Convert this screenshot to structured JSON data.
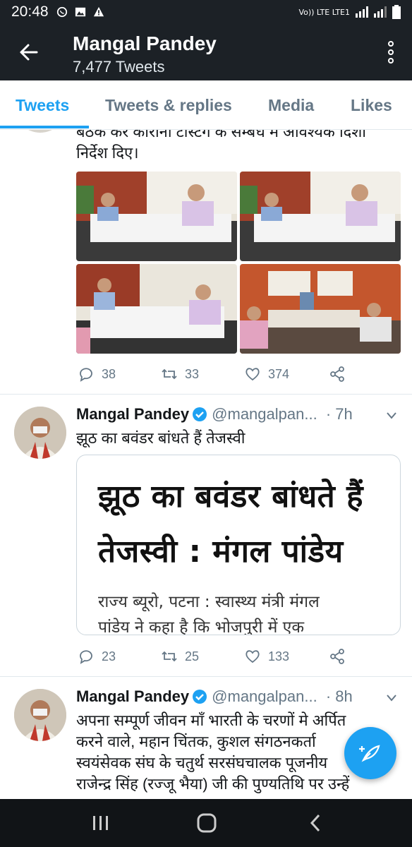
{
  "status_bar": {
    "time": "20:48",
    "network": "Vo)) LTE LTE1",
    "icons": [
      "whatsapp-icon",
      "gallery-icon",
      "warning-icon",
      "signal-icon",
      "battery-icon"
    ]
  },
  "app_bar": {
    "title": "Mangal Pandey",
    "subtitle": "7,477 Tweets"
  },
  "tabs": [
    {
      "label": "Tweets",
      "active": true
    },
    {
      "label": "Tweets & replies",
      "active": false
    },
    {
      "label": "Media",
      "active": false
    },
    {
      "label": "Likes",
      "active": false
    }
  ],
  "tweets": [
    {
      "text_partial": "बैठक कर कोरोना टेस्टिंग के सम्बंध में आवश्यक दिशा",
      "text_line2": "निर्देश दिए।",
      "photos": [
        "meeting-photo-1",
        "meeting-photo-2",
        "meeting-photo-3",
        "meeting-photo-4"
      ],
      "replies": "38",
      "retweets": "33",
      "likes": "374"
    },
    {
      "name": "Mangal Pandey",
      "handle": "@mangalpan...",
      "time": "· 7h",
      "text": "झूठ का बवंडर बांधते हैं तेजस्वी",
      "card": {
        "headline_line1": "झूठ का बवंडर बांधते हैं",
        "headline_line2": "तेजस्वी : मंगल पांडेय",
        "body_line1": "राज्य ब्यूरो, पटना : स्वास्थ्य मंत्री मंगल",
        "body_line2": "पांडेय ने कहा है कि भोजपुरी में एक"
      },
      "replies": "23",
      "retweets": "25",
      "likes": "133"
    },
    {
      "name": "Mangal Pandey",
      "handle": "@mangalpan...",
      "time": "· 8h",
      "lines": [
        "अपना सम्पूर्ण जीवन माँ भारती के चरणों मे अर्पित",
        "करने वाले, महान चिंतक, कुशल संगठनकर्ता",
        "स्वयंसेवक संघ के चतुर्थ सरसंघचालक पूजनीय",
        "राजेन्द्र सिंह (रज्जू भैया) जी की पुण्यतिथि पर उन्हें"
      ]
    }
  ],
  "colors": {
    "accent": "#1da1f2",
    "header_bg": "#1c2126",
    "text_secondary": "#657786"
  }
}
